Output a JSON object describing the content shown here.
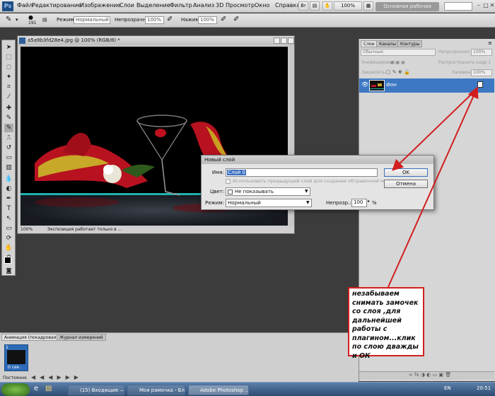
{
  "menubar": {
    "logo": "Ps",
    "items": [
      "Файл",
      "Редактирование",
      "Изображение",
      "Слои",
      "Выделение",
      "Фильтр",
      "Анализ",
      "3D",
      "Просмотр",
      "Окно",
      "Справка"
    ],
    "zoom": "100%",
    "workspace": "Основная рабочая среда"
  },
  "options": {
    "brush_size": "191",
    "mode_label": "Режим:",
    "mode_value": "Нормальный",
    "opacity_label": "Непрозрачность:",
    "opacity_value": "100%",
    "press_label": "Нажим:",
    "press_value": "100%"
  },
  "document": {
    "title": "a5a9b3fd28e4.jpg @ 100% (RGB/8) *",
    "zoom": "100%",
    "status": "Экспозиция работает только в ..."
  },
  "layers_panel": {
    "tabs": [
      "Слои",
      "Каналы",
      "Контуры"
    ],
    "blend": "Обычные",
    "opacity_label": "Непрозрачность:",
    "opacity": "100%",
    "unify_label": "Унифицировать:",
    "propagate_label": "Распространить кадр 1",
    "lock_label": "Закрепить:",
    "fill_label": "Заливка:",
    "fill": "100%",
    "layer_name": "Фон"
  },
  "dialog": {
    "title": "Новый слой",
    "name_label": "Имя:",
    "name_value": "Слой 0",
    "checkbox_label": "Использовать предыдущий слой для создания обтравочной маски",
    "color_label": "Цвет:",
    "color_value": "Не показывать",
    "mode_label": "Режим:",
    "mode_value": "Нормальный",
    "opacity_label": "Непрозр.:",
    "opacity_value": "100",
    "percent": "%",
    "ok": "OK",
    "cancel": "Отмена"
  },
  "animation": {
    "tabs": [
      "Анимация (покадровая)",
      "Журнал измерений"
    ],
    "frame_time": "0 сек.",
    "loop": "Постоянно"
  },
  "taskbar": {
    "tasks": [
      "(15) Входящие — ...",
      "Моя рамочка - Бло...",
      "Adobe Photoshop ..."
    ],
    "lang": "EN",
    "time": "20:51"
  },
  "note": {
    "text": "незабываем снимать замочек со слоя ,для дальнейшей работы с плагином...клик по слою дважды и ОК"
  },
  "colors": {
    "annotation": "#d21e1e",
    "selection": "#3d78c4"
  }
}
